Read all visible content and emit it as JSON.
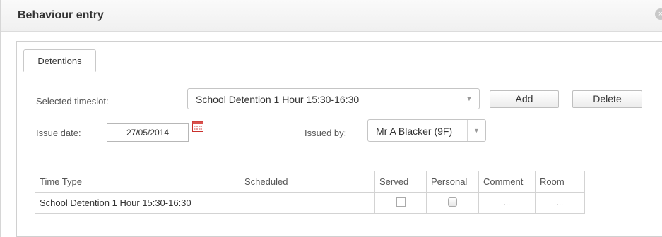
{
  "window": {
    "title": "Behaviour entry",
    "close_symbol": "×"
  },
  "tabs": [
    {
      "label": "Detentions",
      "active": true
    }
  ],
  "form": {
    "timeslot_label": "Selected timeslot:",
    "timeslot_value": "School Detention 1 Hour 15:30-16:30",
    "add_label": "Add",
    "delete_label": "Delete",
    "issue_date_label": "Issue date:",
    "issue_date_value": "27/05/2014",
    "issued_by_label": "Issued by:",
    "issued_by_value": "Mr A Blacker (9F)"
  },
  "table": {
    "columns": [
      "Time Type",
      "Scheduled",
      "Served",
      "Personal",
      "Comment",
      "Room"
    ],
    "rows": [
      {
        "time_type": "School Detention 1 Hour 15:30-16:30",
        "scheduled": "",
        "served": false,
        "personal": false,
        "comment": "...",
        "room": "..."
      }
    ]
  },
  "icons": {
    "calendar": "calendar-icon",
    "dropdown": "chevron-down-icon",
    "close": "close-icon"
  },
  "colors": {
    "calendar_accent": "#d9534f",
    "border": "#c5c5c5"
  }
}
